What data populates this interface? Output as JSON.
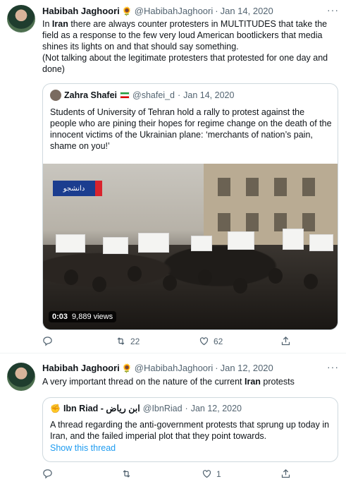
{
  "tweet1": {
    "name": "Habibah Jaghoori",
    "badge": "🌻",
    "handle": "@HabibahJaghoori",
    "dot": "·",
    "date": "Jan 14, 2020",
    "more": "···",
    "text_pre": "In ",
    "text_bold": "Iran",
    "text_post": " there are always counter protesters in MULTITUDES that take the field as a response  to the few very loud American bootlickers that media shines its lights on and that should say something.",
    "text_line2": "(Not talking about the legitimate protesters that protested for one day and done)",
    "quote": {
      "name": "Zahra Shafei",
      "flag": "Iran flag",
      "handle": "@shafei_d",
      "dot": "·",
      "date": "Jan 14, 2020",
      "text": "Students of University of Tehran hold a rally to protest against the people who are pining their hopes for regime change on the death of the innocent victims of the Ukrainian plane: ‘merchants of nation’s pain, shame on you!’",
      "video_logo": "دانشجو",
      "video_time": "0:03",
      "video_views": "9,889 views"
    },
    "actions": {
      "reply_count": "",
      "retweet_count": "22",
      "like_count": "62"
    }
  },
  "tweet2": {
    "name": "Habibah Jaghoori",
    "badge": "🌻",
    "handle": "@HabibahJaghoori",
    "dot": "·",
    "date": "Jan 12, 2020",
    "more": "···",
    "text_pre": "A very important thread on the nature of the current ",
    "text_bold": "Iran",
    "text_post": " protests",
    "quote": {
      "icon": "✊",
      "name": "Ibn Riad - ابن رياض",
      "handle": "@IbnRiad",
      "dot": "·",
      "date": "Jan 12, 2020",
      "text": "A thread regarding the anti-government protests that sprung up today in Iran, and the failed imperial plot that they point towards.",
      "show_thread": "Show this thread"
    },
    "actions": {
      "reply_count": "",
      "retweet_count": "",
      "like_count": "1"
    }
  },
  "colors": {
    "link": "#1d9bf0",
    "muted": "#536471",
    "border": "#cfd9de"
  }
}
